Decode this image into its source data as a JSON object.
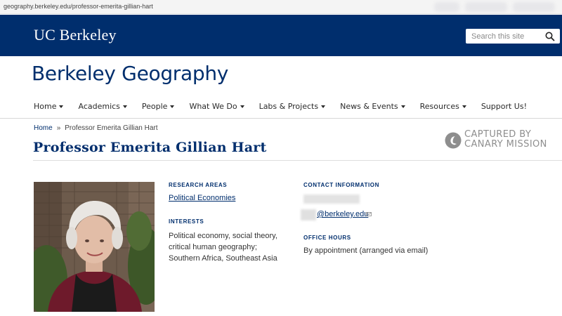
{
  "browser": {
    "url": "geography.berkeley.edu/professor-emerita-gillian-hart"
  },
  "header": {
    "brand": "UC Berkeley",
    "search_placeholder": "Search this site",
    "search_icon": "search-icon"
  },
  "site": {
    "title": "Berkeley Geography"
  },
  "nav": {
    "items": [
      {
        "label": "Home",
        "dropdown": true
      },
      {
        "label": "Academics",
        "dropdown": true
      },
      {
        "label": "People",
        "dropdown": true
      },
      {
        "label": "What We Do",
        "dropdown": true
      },
      {
        "label": "Labs & Projects",
        "dropdown": true
      },
      {
        "label": "News & Events",
        "dropdown": true
      },
      {
        "label": "Resources",
        "dropdown": true
      },
      {
        "label": "Support Us!",
        "dropdown": false
      }
    ]
  },
  "breadcrumb": {
    "home": "Home",
    "separator": "»",
    "current": "Professor Emerita Gillian Hart"
  },
  "page": {
    "title": "Professor Emerita Gillian Hart"
  },
  "watermark": {
    "line1": "CAPTURED BY",
    "line2": "CANARY MISSION"
  },
  "profile": {
    "research_areas_label": "RESEARCH AREAS",
    "research_area": "Political Economies",
    "interests_label": "INTERESTS",
    "interests": "Political economy, social theory, critical human geography; Southern Africa, Southeast Asia",
    "contact_label": "CONTACT INFORMATION",
    "email": "@berkeley.edu",
    "office_hours_label": "OFFICE HOURS",
    "office_hours": "By appointment (arranged via email)"
  },
  "colors": {
    "brand_navy": "#002e6d",
    "link": "#002e6d",
    "watermark_gray": "#8e8e8e"
  }
}
